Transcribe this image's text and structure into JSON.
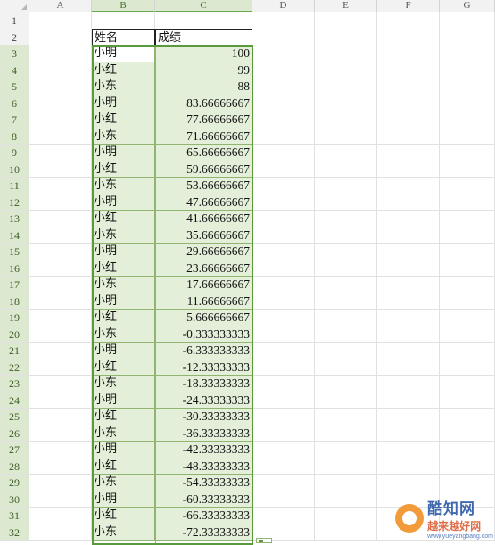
{
  "columns": [
    {
      "label": "A",
      "width": 70,
      "sel": false
    },
    {
      "label": "B",
      "width": 71,
      "sel": true
    },
    {
      "label": "C",
      "width": 109,
      "sel": true
    },
    {
      "label": "D",
      "width": 70,
      "sel": false
    },
    {
      "label": "E",
      "width": 70,
      "sel": false
    },
    {
      "label": "F",
      "width": 70,
      "sel": false
    },
    {
      "label": "G",
      "width": 62,
      "sel": false
    }
  ],
  "rows": [
    {
      "n": "1",
      "name": "",
      "score": ""
    },
    {
      "n": "2",
      "name": "姓名",
      "score": "成绩"
    },
    {
      "n": "3",
      "name": "小明",
      "score": "100"
    },
    {
      "n": "4",
      "name": "小红",
      "score": "99"
    },
    {
      "n": "5",
      "name": "小东",
      "score": "88"
    },
    {
      "n": "6",
      "name": "小明",
      "score": "83.66666667"
    },
    {
      "n": "7",
      "name": "小红",
      "score": "77.66666667"
    },
    {
      "n": "8",
      "name": "小东",
      "score": "71.66666667"
    },
    {
      "n": "9",
      "name": "小明",
      "score": "65.66666667"
    },
    {
      "n": "10",
      "name": "小红",
      "score": "59.66666667"
    },
    {
      "n": "11",
      "name": "小东",
      "score": "53.66666667"
    },
    {
      "n": "12",
      "name": "小明",
      "score": "47.66666667"
    },
    {
      "n": "13",
      "name": "小红",
      "score": "41.66666667"
    },
    {
      "n": "14",
      "name": "小东",
      "score": "35.66666667"
    },
    {
      "n": "15",
      "name": "小明",
      "score": "29.66666667"
    },
    {
      "n": "16",
      "name": "小红",
      "score": "23.66666667"
    },
    {
      "n": "17",
      "name": "小东",
      "score": "17.66666667"
    },
    {
      "n": "18",
      "name": "小明",
      "score": "11.66666667"
    },
    {
      "n": "19",
      "name": "小红",
      "score": "5.666666667"
    },
    {
      "n": "20",
      "name": "小东",
      "score": "-0.333333333"
    },
    {
      "n": "21",
      "name": "小明",
      "score": "-6.333333333"
    },
    {
      "n": "22",
      "name": "小红",
      "score": "-12.33333333"
    },
    {
      "n": "23",
      "name": "小东",
      "score": "-18.33333333"
    },
    {
      "n": "24",
      "name": "小明",
      "score": "-24.33333333"
    },
    {
      "n": "25",
      "name": "小红",
      "score": "-30.33333333"
    },
    {
      "n": "26",
      "name": "小东",
      "score": "-36.33333333"
    },
    {
      "n": "27",
      "name": "小明",
      "score": "-42.33333333"
    },
    {
      "n": "28",
      "name": "小红",
      "score": "-48.33333333"
    },
    {
      "n": "29",
      "name": "小东",
      "score": "-54.33333333"
    },
    {
      "n": "30",
      "name": "小明",
      "score": "-60.33333333"
    },
    {
      "n": "31",
      "name": "小红",
      "score": "-66.33333333"
    },
    {
      "n": "32",
      "name": "小东",
      "score": "-72.33333333"
    }
  ],
  "watermark": {
    "title": "酷知网",
    "subtitle": "越来越好网",
    "url": "www.yueyangbang.com",
    "logo_color": "#f29b3a"
  },
  "colors": {
    "selection_fill": "#e3efd9",
    "selection_border": "#5a9a3c",
    "header_fill": "#f2f2f2"
  }
}
